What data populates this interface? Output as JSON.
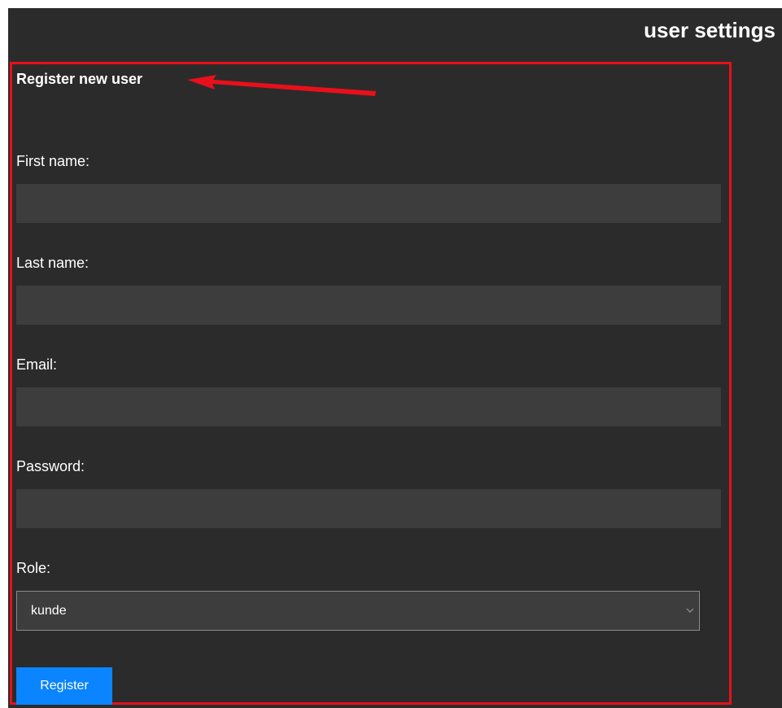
{
  "header": {
    "title": "user settings"
  },
  "form": {
    "section_title": "Register new user",
    "fields": [
      {
        "label": "First name:",
        "value": ""
      },
      {
        "label": "Last name:",
        "value": ""
      },
      {
        "label": "Email:",
        "value": ""
      },
      {
        "label": "Password:",
        "value": ""
      }
    ],
    "role": {
      "label": "Role:",
      "selected": "kunde"
    },
    "submit_label": "Register"
  },
  "colors": {
    "background": "#2b2b2b",
    "input_background": "#3d3d3d",
    "highlight_border": "#e8101a",
    "annotation_arrow": "#e8101a",
    "button": "#0a84ff",
    "text": "#ffffff"
  },
  "icons": {
    "select_arrow": "chevron-down-icon",
    "annotation": "arrow-left-icon"
  }
}
